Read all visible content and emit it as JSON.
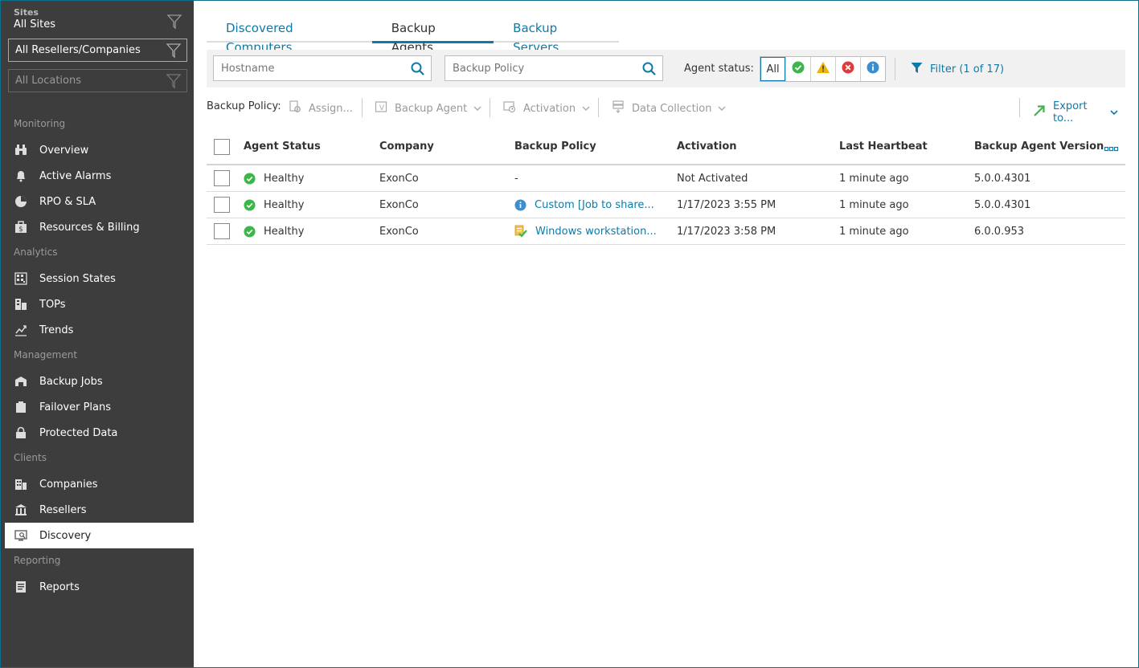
{
  "sidebar": {
    "sites_caption": "Sites",
    "sites_value": "All Sites",
    "resellers_dropdown": "All Resellers/Companies",
    "locations_dropdown": "All Locations",
    "sections": {
      "monitoring": "Monitoring",
      "analytics": "Analytics",
      "management": "Management",
      "clients": "Clients",
      "reporting": "Reporting"
    },
    "items": {
      "overview": "Overview",
      "active_alarms": "Active Alarms",
      "rpo_sla": "RPO & SLA",
      "resources_billing": "Resources & Billing",
      "session_states": "Session States",
      "tops": "TOPs",
      "trends": "Trends",
      "backup_jobs": "Backup Jobs",
      "failover_plans": "Failover Plans",
      "protected_data": "Protected Data",
      "companies": "Companies",
      "resellers": "Resellers",
      "discovery": "Discovery",
      "reports": "Reports"
    },
    "active_item": "Discovery"
  },
  "tabs": [
    {
      "label": "Discovered Computers",
      "active": false
    },
    {
      "label": "Backup Agents",
      "active": true
    },
    {
      "label": "Backup Servers",
      "active": false
    }
  ],
  "filters": {
    "hostname_placeholder": "Hostname",
    "policy_placeholder": "Backup Policy",
    "agent_status_label": "Agent status:",
    "status_all": "All",
    "filter_button": "Filter (1 of 17)"
  },
  "actions": {
    "backup_policy_label": "Backup Policy:",
    "assign": "Assign...",
    "backup_agent": "Backup Agent",
    "activation": "Activation",
    "data_collection": "Data Collection",
    "export": "Export to..."
  },
  "table": {
    "headers": {
      "agent_status": "Agent Status",
      "company": "Company",
      "backup_policy": "Backup Policy",
      "activation": "Activation",
      "last_heartbeat": "Last Heartbeat",
      "version": "Backup Agent Version"
    },
    "rows": [
      {
        "status": "Healthy",
        "company": "ExonCo",
        "policy": "-",
        "policy_icon": "none",
        "activation": "Not Activated",
        "heartbeat": "1 minute ago",
        "version": "5.0.0.4301"
      },
      {
        "status": "Healthy",
        "company": "ExonCo",
        "policy": "Custom [Job to share...",
        "policy_icon": "info-icon",
        "activation": "1/17/2023 3:55 PM",
        "heartbeat": "1 minute ago",
        "version": "5.0.0.4301"
      },
      {
        "status": "Healthy",
        "company": "ExonCo",
        "policy": "Windows workstation...",
        "policy_icon": "policy-applied-icon",
        "activation": "1/17/2023 3:58 PM",
        "heartbeat": "1 minute ago",
        "version": "6.0.0.953"
      }
    ]
  },
  "colors": {
    "accent": "#0e7aa8",
    "sidebar_bg": "#3d3d3d",
    "healthy": "#3cb54a",
    "warning": "#f0b400",
    "error": "#e0393e",
    "info": "#3a8fd0"
  }
}
